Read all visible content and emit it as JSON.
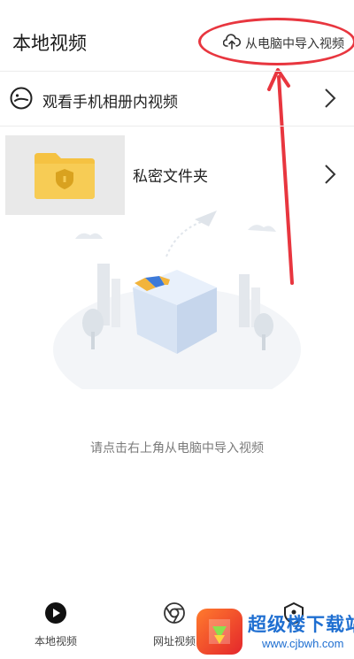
{
  "header": {
    "title": "本地视频",
    "import_label": "从电脑中导入视频"
  },
  "rows": [
    {
      "label": "观看手机相册内视频",
      "icon": "smile-face-icon"
    },
    {
      "label": "私密文件夹",
      "icon": "locked-folder-icon"
    }
  ],
  "empty_state": {
    "message": "请点击右上角从电脑中导入视频"
  },
  "tabs": [
    {
      "label": "本地视频",
      "icon": "play-circle-icon",
      "active": true
    },
    {
      "label": "网址视频",
      "icon": "browser-icon",
      "active": false
    },
    {
      "label": "",
      "icon": "shield-icon",
      "active": false
    }
  ],
  "watermark": {
    "text": "超级楼下载站",
    "url": "www.cjbwh.com"
  },
  "colors": {
    "annotation_red": "#e8363f",
    "folder_yellow": "#f5c242",
    "watermark_blue": "#1f6fd1"
  }
}
